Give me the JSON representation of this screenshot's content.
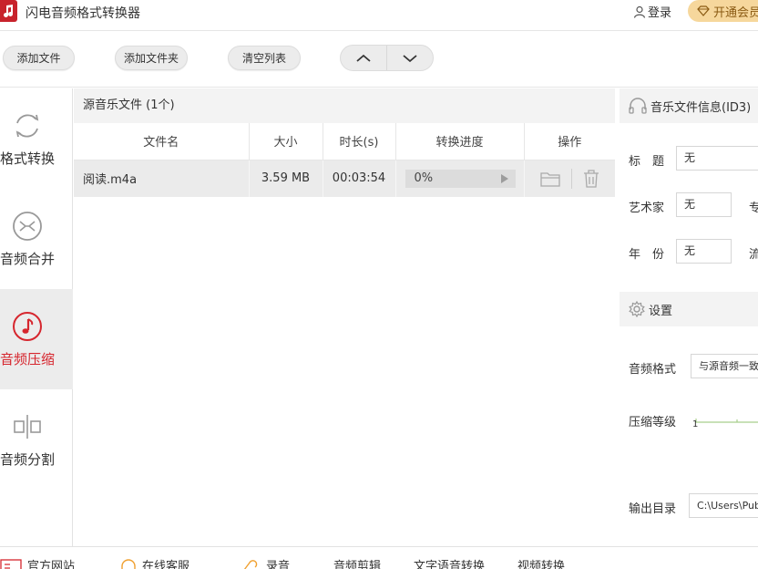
{
  "app": {
    "title": "闪电音频格式转换器",
    "login_label": "登录",
    "vip_label": "开通会员"
  },
  "toolbar": {
    "add_file": "添加文件",
    "add_folder": "添加文件夹",
    "clear_list": "清空列表"
  },
  "sidebar": {
    "items": [
      {
        "label": "格式转换",
        "icon": "refresh-icon",
        "active": false
      },
      {
        "label": "音频合并",
        "icon": "merge-icon",
        "active": false
      },
      {
        "label": "音频压缩",
        "icon": "music-note-icon",
        "active": true
      },
      {
        "label": "音频分割",
        "icon": "split-icon",
        "active": false
      }
    ]
  },
  "file_panel": {
    "header": "源音乐文件 (1个)",
    "columns": [
      "文件名",
      "大小",
      "时长(s)",
      "转换进度",
      "操作"
    ],
    "rows": [
      {
        "name": "阅读.m4a",
        "size": "3.59 MB",
        "duration": "00:03:54",
        "progress": "0%"
      }
    ]
  },
  "info_panel": {
    "header": "音乐文件信息(ID3)",
    "title_label": "标　题",
    "title_value": "无",
    "artist_label": "艺术家",
    "artist_value": "无",
    "album_label_partial": "专",
    "year_label": "年　份",
    "year_value": "无",
    "genre_label_partial": "流"
  },
  "settings": {
    "header": "设置",
    "format_label": "音频格式",
    "format_value": "与源音频一致",
    "compress_label": "压缩等级",
    "compress_min": "1",
    "output_label": "输出目录",
    "output_value": "C:\\Users\\Public"
  },
  "bottom_bar": {
    "items": [
      "官方网站",
      "在线客服",
      "录音",
      "音频剪辑",
      "文字语音转换",
      "视频转换"
    ]
  },
  "colors": {
    "accent": "#d6262e",
    "vip": "#f6d79c"
  }
}
